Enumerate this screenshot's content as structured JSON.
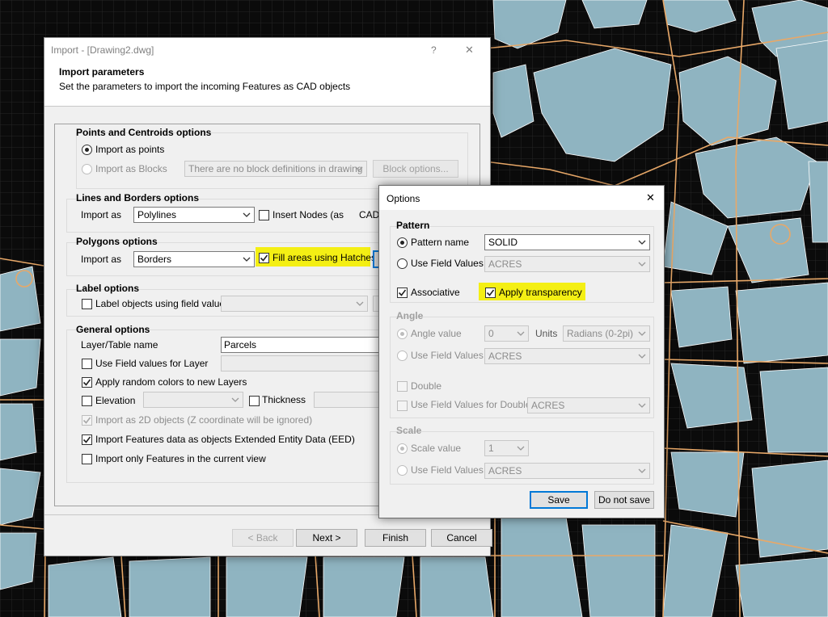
{
  "import_dialog": {
    "title": "Import -  [Drawing2.dwg]",
    "help": "?",
    "close": "✕",
    "heading": "Import parameters",
    "subheading": "Set the parameters to import the incoming Features as CAD objects",
    "points": {
      "title": "Points and Centroids options",
      "import_points": "Import as points",
      "import_blocks": "Import as Blocks",
      "blocks_combo": "There are no block definitions in drawing",
      "block_options": "Block options..."
    },
    "lines": {
      "title": "Lines and Borders options",
      "import_as": "Import as",
      "combo": "Polylines",
      "insert_nodes": "Insert Nodes (as",
      "cad_label": "CAD"
    },
    "polygons": {
      "title": "Polygons options",
      "import_as": "Import as",
      "combo": "Borders",
      "fill_hatches": "Fill areas using Hatches"
    },
    "labels": {
      "title": "Label options",
      "label_objects": "Label objects using field value"
    },
    "general": {
      "title": "General options",
      "layer_label": "Layer/Table name",
      "layer_value": "Parcels",
      "use_field_values": "Use Field values for Layer",
      "random_colors": "Apply random colors to new Layers",
      "elevation": "Elevation",
      "thickness": "Thickness",
      "import_2d": "Import as 2D objects (Z coordinate will be ignored)",
      "import_eed": "Import Features data as objects Extended Entity Data (EED)",
      "current_view": "Import only Features in the current view"
    },
    "buttons": {
      "back": "< Back",
      "next": "Next >",
      "finish": "Finish",
      "cancel": "Cancel"
    }
  },
  "options_dialog": {
    "title": "Options",
    "close": "✕",
    "pattern": {
      "title": "Pattern",
      "pattern_name": "Pattern name",
      "pattern_value": "SOLID",
      "use_field_values": "Use Field Values",
      "field_value": "ACRES",
      "associative": "Associative",
      "apply_transparency": "Apply transparency"
    },
    "angle": {
      "title": "Angle",
      "angle_value": "Angle value",
      "angle_input": "0",
      "units_label": "Units",
      "units_value": "Radians (0-2pi)",
      "use_field_values": "Use Field Values",
      "field_value": "ACRES",
      "double": "Double",
      "use_field_double": "Use Field Values for Double",
      "double_field": "ACRES"
    },
    "scale": {
      "title": "Scale",
      "scale_value": "Scale value",
      "scale_input": "1",
      "use_field_values": "Use Field Values",
      "field_value": "ACRES"
    },
    "buttons": {
      "save": "Save",
      "do_not_save": "Do not save"
    }
  },
  "colors": {
    "map_background": "#0b0b0b",
    "parcel_fill": "#8fb4c1",
    "road_line": "#e8a868",
    "grid": "#2a2a2a",
    "highlight": "#f4ef14",
    "accent": "#0078d7"
  }
}
